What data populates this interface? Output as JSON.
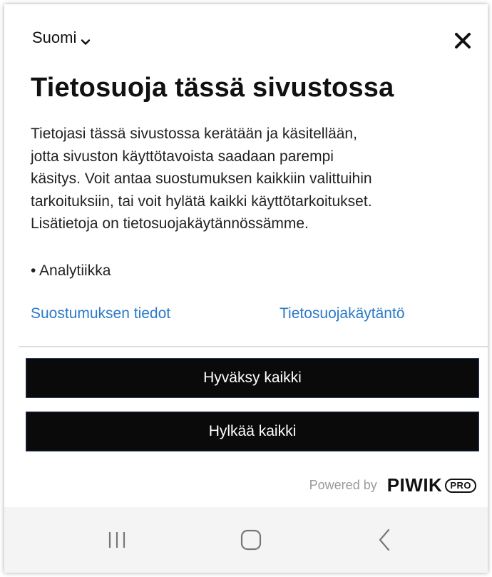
{
  "header": {
    "language": "Suomi"
  },
  "dialog": {
    "title": "Tietosuoja tässä sivustossa",
    "body_lines": [
      "Tietojasi tässä sivustossa kerätään ja käsitellään,",
      "jotta sivuston käyttötavoista saadaan parempi",
      "käsitys. Voit antaa suostumuksen kaikkiin valittuihin",
      "tarkoituksiin, tai voit hylätä kaikki käyttötarkoitukset.",
      "Lisätietoja on tietosuojakäytännössämme."
    ],
    "purposes": [
      "• Analytiikka"
    ],
    "links": {
      "consent_details": "Suostumuksen tiedot",
      "privacy_policy": "Tietosuojakäytäntö"
    },
    "buttons": {
      "accept_all": "Hyväksy kaikki",
      "reject_all": "Hylkää kaikki"
    }
  },
  "footer": {
    "powered_by": "Powered by",
    "logo_word": "PIWIK",
    "logo_badge": "PRO"
  },
  "icons": {
    "language_dropdown": "chevron-down-icon",
    "close": "close-icon",
    "recents": "recents-icon",
    "home": "home-icon",
    "back": "back-icon"
  },
  "colors": {
    "link": "#2b7ac8",
    "button_bg": "#0a0a0a",
    "button_text": "#ffffff",
    "navbar_bg": "#f4f4f4",
    "powered_text": "#9a9a9a"
  }
}
